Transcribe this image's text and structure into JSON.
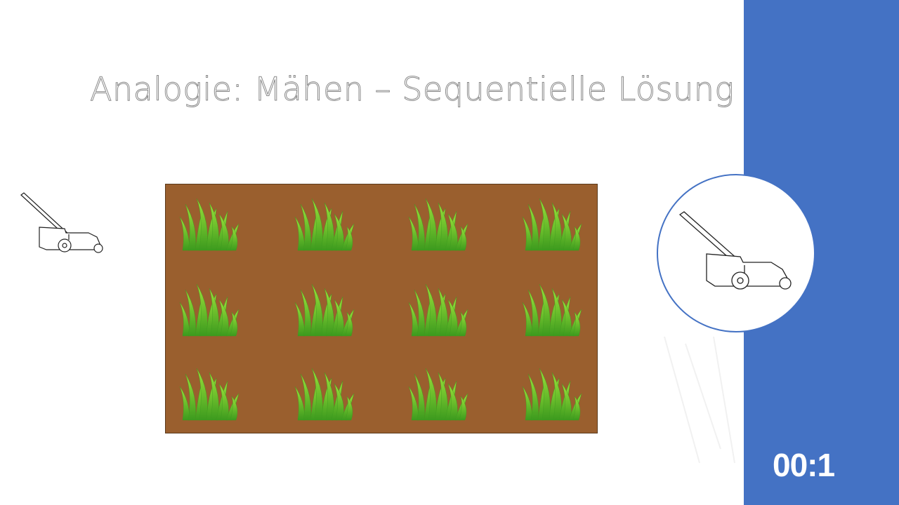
{
  "slide": {
    "title": "Analogie: Mähen – Sequentielle Lösung",
    "timer": "00:1"
  },
  "colors": {
    "accent_panel": "#4472c4",
    "field_soil": "#9a5f2e",
    "grass_light": "#9be23a",
    "grass_dark": "#3c9a1e"
  },
  "field": {
    "rows": 3,
    "columns": 4,
    "tuft_icon": "grass-tuft-icon"
  },
  "icons": {
    "small": "lawn-mower-icon",
    "highlighted": "lawn-mower-icon"
  }
}
